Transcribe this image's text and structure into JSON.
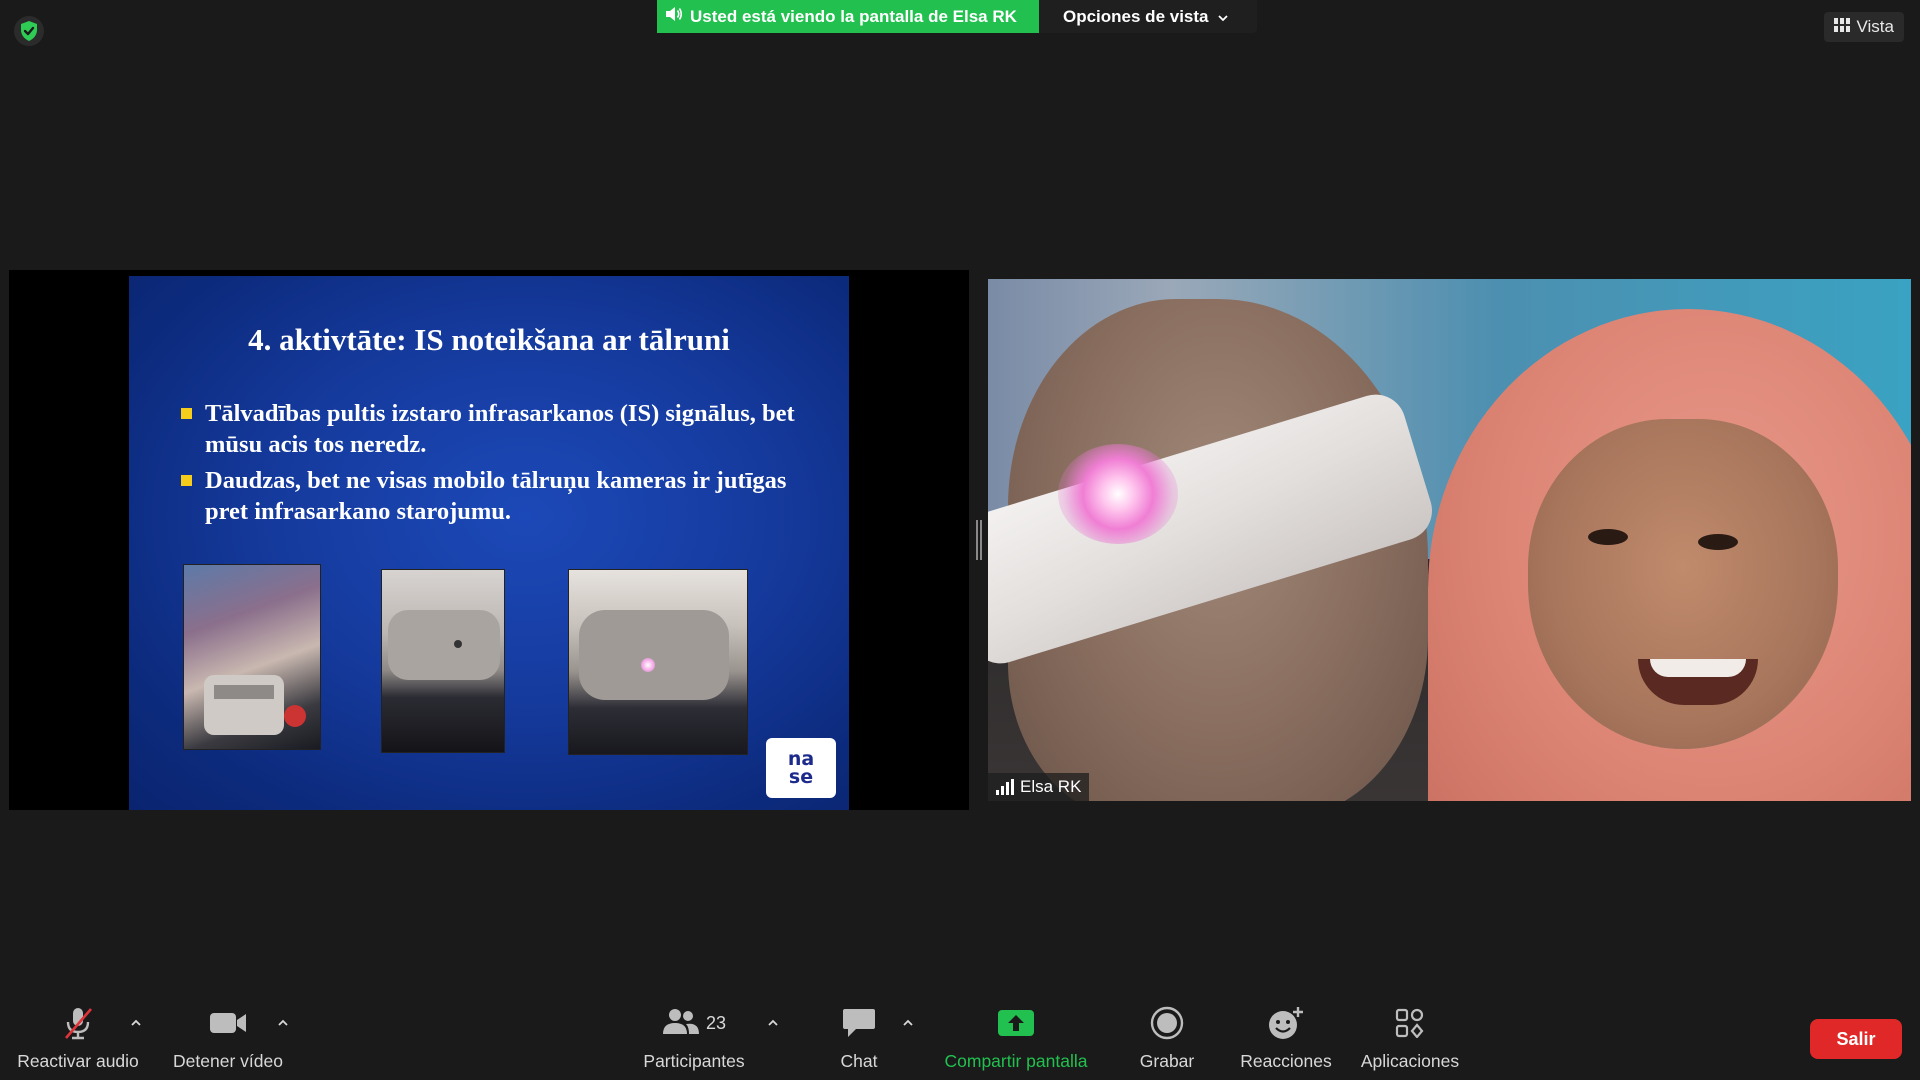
{
  "banner": {
    "sharing_text": "Usted está viendo la pantalla de Elsa RK",
    "view_options": "Opciones de vista"
  },
  "view_button": {
    "label": "Vista"
  },
  "slide": {
    "title": "4. aktivtāte: IS noteikšana ar tālruni",
    "bullets": [
      "Tālvadības pultis izstaro infrasarkanos (IS) signālus, bet mūsu acis tos neredz.",
      "Daudzas, bet ne visas mobilo tālruņu kameras ir jutīgas pret infrasarkano starojumu."
    ],
    "logo_text": "nase"
  },
  "participant": {
    "name": "Elsa RK"
  },
  "toolbar": {
    "unmute": "Reactivar audio",
    "stop_video": "Detener vídeo",
    "participants": "Participantes",
    "participants_count": "23",
    "chat": "Chat",
    "share_screen": "Compartir pantalla",
    "record": "Grabar",
    "reactions": "Reacciones",
    "apps": "Aplicaciones",
    "leave": "Salir"
  },
  "colors": {
    "share_green": "#22c04f",
    "leave_red": "#e02828",
    "bullet_yellow": "#f6cd1a",
    "muted_red": "#e0343a"
  }
}
